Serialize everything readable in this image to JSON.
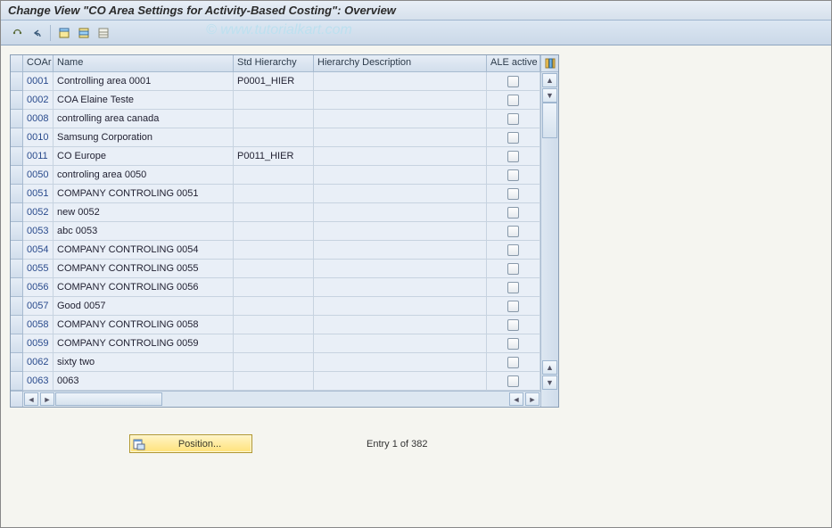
{
  "title": "Change View \"CO Area Settings for Activity-Based Costing\": Overview",
  "watermark": "© www.tutorialkart.com",
  "toolbar": {
    "icons": [
      "change-icon",
      "undo-icon",
      "select-all-icon",
      "select-block-icon",
      "deselect-all-icon"
    ]
  },
  "columns": {
    "coar": "COAr",
    "name": "Name",
    "std": "Std Hierarchy",
    "hdesc": "Hierarchy Description",
    "ale": "ALE active"
  },
  "rows": [
    {
      "coar": "0001",
      "name": "Controlling area 0001",
      "std": "P0001_HIER",
      "hdesc": "",
      "ale": false
    },
    {
      "coar": "0002",
      "name": "COA Elaine Teste",
      "std": "",
      "hdesc": "",
      "ale": false
    },
    {
      "coar": "0008",
      "name": "controlling area canada",
      "std": "",
      "hdesc": "",
      "ale": false
    },
    {
      "coar": "0010",
      "name": "Samsung Corporation",
      "std": "",
      "hdesc": "",
      "ale": false
    },
    {
      "coar": "0011",
      "name": "CO Europe",
      "std": "P0011_HIER",
      "hdesc": "",
      "ale": false
    },
    {
      "coar": "0050",
      "name": "controling area 0050",
      "std": "",
      "hdesc": "",
      "ale": false
    },
    {
      "coar": "0051",
      "name": "COMPANY CONTROLING 0051",
      "std": "",
      "hdesc": "",
      "ale": false
    },
    {
      "coar": "0052",
      "name": "new 0052",
      "std": "",
      "hdesc": "",
      "ale": false
    },
    {
      "coar": "0053",
      "name": "abc 0053",
      "std": "",
      "hdesc": "",
      "ale": false
    },
    {
      "coar": "0054",
      "name": "COMPANY CONTROLING 0054",
      "std": "",
      "hdesc": "",
      "ale": false
    },
    {
      "coar": "0055",
      "name": "COMPANY CONTROLING 0055",
      "std": "",
      "hdesc": "",
      "ale": false
    },
    {
      "coar": "0056",
      "name": "COMPANY CONTROLING 0056",
      "std": "",
      "hdesc": "",
      "ale": false
    },
    {
      "coar": "0057",
      "name": "Good 0057",
      "std": "",
      "hdesc": "",
      "ale": false
    },
    {
      "coar": "0058",
      "name": "COMPANY CONTROLING 0058",
      "std": "",
      "hdesc": "",
      "ale": false
    },
    {
      "coar": "0059",
      "name": "COMPANY CONTROLING 0059",
      "std": "",
      "hdesc": "",
      "ale": false
    },
    {
      "coar": "0062",
      "name": "sixty two",
      "std": "",
      "hdesc": "",
      "ale": false
    },
    {
      "coar": "0063",
      "name": "0063",
      "std": "",
      "hdesc": "",
      "ale": false
    }
  ],
  "position_button": "Position...",
  "entry_text": "Entry 1 of 382"
}
